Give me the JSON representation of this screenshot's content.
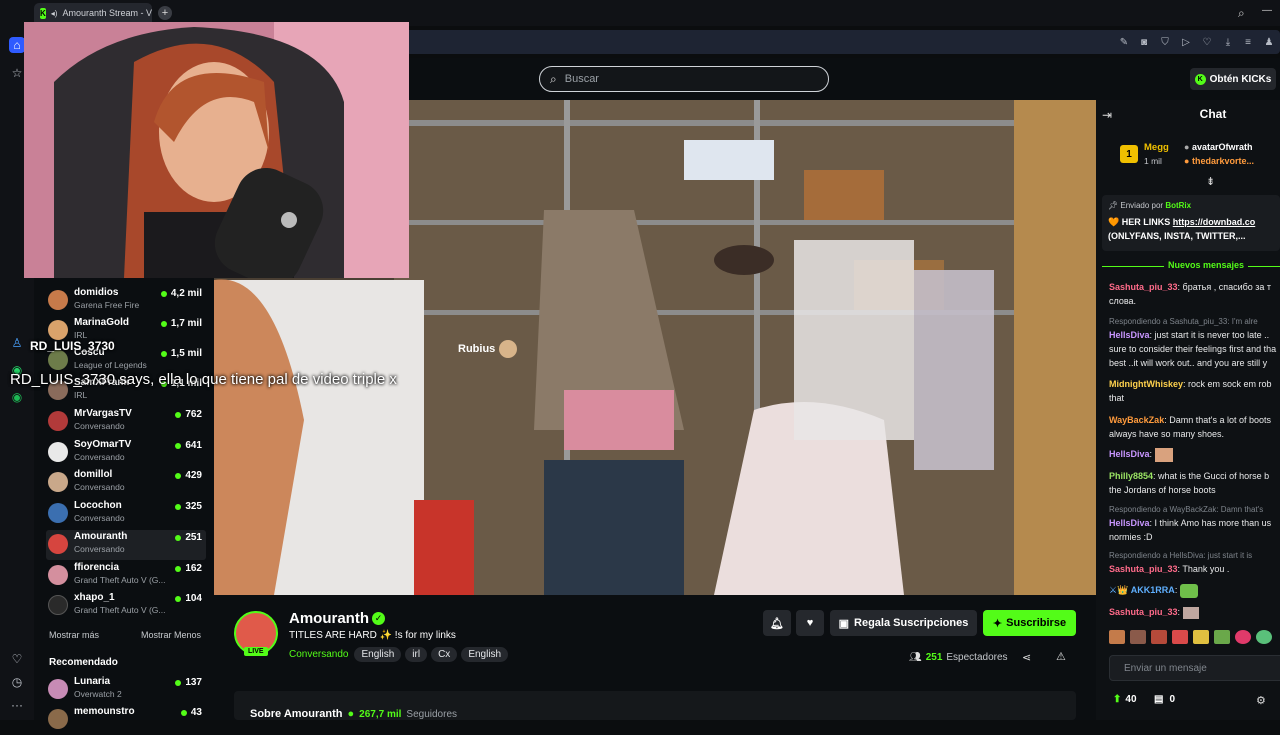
{
  "browser": {
    "tab_title": "Amouranth Stream - Vi",
    "new_tab_label": "+"
  },
  "header": {
    "search_placeholder": "Buscar",
    "get_kicks_label": "Obtén KICKs"
  },
  "overlay": {
    "rubius_label": "Rubius",
    "tts_user": "RD_LUIS_3730",
    "tts_message": "RD_LUIS_3730 says, ella lo que tiene pal de video triple x"
  },
  "sidebar": {
    "channels": [
      {
        "name": "domidios",
        "category": "Garena Free Fire",
        "viewers": "4,2 mil",
        "color": "#c77a4a"
      },
      {
        "name": "MarinaGold",
        "category": "IRL",
        "viewers": "1,7 mil",
        "color": "#d9a26b"
      },
      {
        "name": "Coscu",
        "category": "League of Legends",
        "viewers": "1,5 mil",
        "color": "#6d7c4a"
      },
      {
        "name": "SamXFrank",
        "category": "IRL",
        "viewers": "1,1 mil",
        "color": "#8a6b5b"
      },
      {
        "name": "MrVargasTV",
        "category": "Conversando",
        "viewers": "762",
        "color": "#b23a3a"
      },
      {
        "name": "SoyOmarTV",
        "category": "Conversando",
        "viewers": "641",
        "color": "#e9e9e9"
      },
      {
        "name": "domillol",
        "category": "Conversando",
        "viewers": "429",
        "color": "#c9a88a"
      },
      {
        "name": "Locochon",
        "category": "Conversando",
        "viewers": "325",
        "color": "#3b6fb0"
      },
      {
        "name": "Amouranth",
        "category": "Conversando",
        "viewers": "251",
        "color": "#d6453f"
      },
      {
        "name": "ffiorencia",
        "category": "Grand Theft Auto V (G...",
        "viewers": "162",
        "color": "#d48f9e"
      },
      {
        "name": "xhapo_1",
        "category": "Grand Theft Auto V (G...",
        "viewers": "104",
        "color": "#2a2a2a"
      }
    ],
    "show_more": "Mostrar más",
    "show_less": "Mostrar Menos",
    "recommended_title": "Recomendado",
    "recommended": [
      {
        "name": "Lunaria",
        "category": "Overwatch 2",
        "viewers": "137",
        "color": "#c78bb5"
      },
      {
        "name": "memounstro",
        "category": "",
        "viewers": "43",
        "color": "#8a6a4a"
      }
    ]
  },
  "stream": {
    "streamer": "Amouranth",
    "live_badge": "LIVE",
    "title": "TITLES ARE HARD ✨ !s for my links",
    "category": "Conversando",
    "tags": [
      "English",
      "irl",
      "Cx",
      "English"
    ],
    "gift_subs_label": "Regala Suscripciones",
    "subscribe_label": "Suscribirse",
    "viewers_count": "251",
    "viewers_label": "Espectadores",
    "about_title": "Sobre Amouranth",
    "followers_count": "267,7 mil",
    "followers_label": "Seguidores"
  },
  "chat": {
    "title": "Chat",
    "top_gifters": [
      {
        "name": "Megg",
        "detail": "1 mil"
      },
      {
        "name": "avatarOfwrath",
        "detail": "thedarkvorte..."
      }
    ],
    "pinned_sender_label": "Enviado por",
    "pinned_sender": "BotRix",
    "pinned_line1_prefix": "HER LINKS ",
    "pinned_link": "https://downbad.co",
    "pinned_line2": "(ONLYFANS, INSTA, TWITTER,...",
    "new_messages_label": "Nuevos mensajes",
    "messages": [
      {
        "user": "Sashuta_piu_33",
        "color": "#ff6b8a",
        "line1": "братья , спасибо за т",
        "line2": "слова."
      },
      {
        "reply": "Respondiendo a Sashuta_piu_33: I'm alre"
      },
      {
        "user": "HellsDiva",
        "color": "#c896ff",
        "line1": "just start it is never too late ..",
        "line2": "sure to consider their feelings first and tha",
        "line3": "best ..it will work out.. and you are still y"
      },
      {
        "user": "MidnightWhiskey",
        "color": "#ffd24d",
        "line1": "rock em sock em rob",
        "line2": "that"
      },
      {
        "user": "WayBackZak",
        "color": "#ff9b3d",
        "line1": "Damn that's a lot of boots",
        "line2": "always have so many shoes."
      },
      {
        "user": "HellsDiva",
        "color": "#c896ff",
        "line1": ""
      },
      {
        "user": "Philly8854",
        "color": "#9be564",
        "line1": "what is the Gucci of horse b",
        "line2": "the Jordans of horse boots"
      },
      {
        "reply": "Respondiendo a WayBackZak: Damn that's"
      },
      {
        "user": "HellsDiva",
        "color": "#c896ff",
        "line1": "I think Amo has more than us",
        "line2": "normies :D"
      },
      {
        "reply": "Respondiendo a HellsDiva: just start it is"
      },
      {
        "user": "Sashuta_piu_33",
        "color": "#ff6b8a",
        "line1": "Thank you ."
      },
      {
        "user": "AKK1RRA",
        "color": "#5fb0ff",
        "line1": ""
      },
      {
        "user": "Sashuta_piu_33",
        "color": "#ff6b8a",
        "line1": ""
      }
    ],
    "input_placeholder": "Enviar un mensaje",
    "kicks_count": "40",
    "gift_count": "0"
  }
}
